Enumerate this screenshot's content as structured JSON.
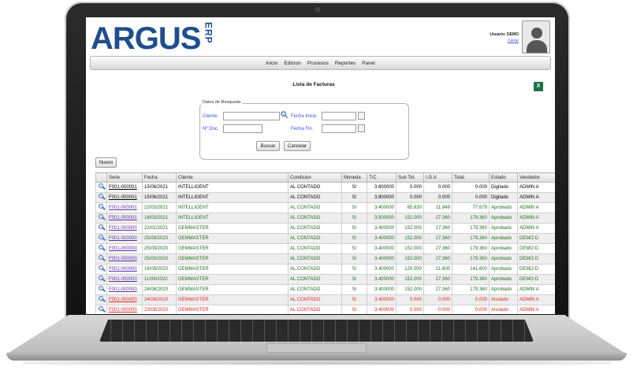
{
  "app": {
    "logo_text": "ARGUS",
    "logo_suffix": "ERP",
    "user_label": "Usuario: DEMO",
    "logout_label": "Cerrar"
  },
  "menu": [
    "Inicio",
    "Edicion",
    "Procesos",
    "Reportes",
    "Panel"
  ],
  "page_title": "Lista de Facturas",
  "search": {
    "legend": "Datos de Búsqueda",
    "cliente_label": "Cliente",
    "ndoc_label": "Nº Doc.",
    "fecha_inicio_label": "Fecha Inicio.",
    "fecha_fin_label": "Fecha Fin.",
    "buscar_label": "Buscar",
    "cancelar_label": "Cancelar"
  },
  "nuevo_label": "Nuevo",
  "table": {
    "headers": [
      "",
      "Serie",
      "Fecha",
      "Cliente",
      "Condicion",
      "Moneda",
      "T/C",
      "Sub Tot.",
      "I.G.V.",
      "Total",
      "Estado",
      "Vendedor"
    ],
    "rows": [
      {
        "status": "pending",
        "serie": "F001-000001",
        "fecha": "15/06/2021",
        "cliente": "INTELLIGENT",
        "condicion": "AL CONTADO",
        "moneda": "S/",
        "tc": "3.800000",
        "subtot": "0.000",
        "igv": "0.000",
        "total": "0.000",
        "estado": "Digitado",
        "vendedor": "ADMIN A"
      },
      {
        "status": "pending",
        "serie": "F001-000001",
        "fecha": "15/06/2021",
        "cliente": "INTELLIGENT",
        "condicion": "AL CONTADO",
        "moneda": "S/",
        "tc": "3.800000",
        "subtot": "0.000",
        "igv": "0.000",
        "total": "0.000",
        "estado": "Digitado",
        "vendedor": "ADMIN A"
      },
      {
        "status": "ok",
        "serie": "F001-000001",
        "fecha": "22/03/2021",
        "cliente": "INTELLIGENT",
        "condicion": "AL CONTADO",
        "moneda": "S/",
        "tc": "3.400000",
        "subtot": "65.830",
        "igv": "11.849",
        "total": "77.679",
        "estado": "Aprobado",
        "vendedor": "ADMIN A"
      },
      {
        "status": "ok",
        "serie": "F001-000001",
        "fecha": "16/03/2021",
        "cliente": "INTELLIGENT",
        "condicion": "AL CONTADO",
        "moneda": "S/",
        "tc": "3.500000",
        "subtot": "152.000",
        "igv": "27.360",
        "total": "179.360",
        "estado": "Aprobado",
        "vendedor": "ADMIN A"
      },
      {
        "status": "ok",
        "serie": "F001-000000",
        "fecha": "22/01/2021",
        "cliente": "GEMMASTER",
        "condicion": "AL CONTADO",
        "moneda": "S/",
        "tc": "3.400000",
        "subtot": "152.000",
        "igv": "27.360",
        "total": "179.360",
        "estado": "Aprobado",
        "vendedor": "ADMIN A"
      },
      {
        "status": "ok",
        "serie": "F001-000000",
        "fecha": "25/09/2020",
        "cliente": "GEMMASTER",
        "condicion": "AL CONTADO",
        "moneda": "S/",
        "tc": "3.400000",
        "subtot": "152.000",
        "igv": "27.360",
        "total": "179.360",
        "estado": "Aprobado",
        "vendedor": "DEMO D"
      },
      {
        "status": "ok",
        "serie": "F001-000000",
        "fecha": "25/09/2020",
        "cliente": "GEMMASTER",
        "condicion": "AL CONTADO",
        "moneda": "S/",
        "tc": "3.400000",
        "subtot": "152.000",
        "igv": "27.360",
        "total": "179.360",
        "estado": "Aprobado",
        "vendedor": "DEMO D"
      },
      {
        "status": "ok",
        "serie": "F001-000000",
        "fecha": "25/09/2020",
        "cliente": "GEMMASTER",
        "condicion": "AL CONTADO",
        "moneda": "S/",
        "tc": "3.400000",
        "subtot": "152.000",
        "igv": "27.360",
        "total": "179.360",
        "estado": "Aprobado",
        "vendedor": "DEMO D"
      },
      {
        "status": "ok",
        "serie": "F001-000000",
        "fecha": "16/09/2020",
        "cliente": "GEMMASTER",
        "condicion": "AL CONTADO",
        "moneda": "S/",
        "tc": "3.400000",
        "subtot": "120.000",
        "igv": "21.600",
        "total": "141.600",
        "estado": "Aprobado",
        "vendedor": "DEMO D"
      },
      {
        "status": "ok",
        "serie": "F001-000000",
        "fecha": "11/09/2020",
        "cliente": "GEMMASTER",
        "condicion": "AL CONTADO",
        "moneda": "S/",
        "tc": "3.400000",
        "subtot": "152.000",
        "igv": "27.360",
        "total": "179.360",
        "estado": "Aprobado",
        "vendedor": "DEMO D"
      },
      {
        "status": "ok",
        "serie": "F001-000000",
        "fecha": "24/08/2020",
        "cliente": "GEMMASTER",
        "condicion": "AL CONTADO",
        "moneda": "S/",
        "tc": "3.400000",
        "subtot": "152.000",
        "igv": "27.360",
        "total": "179.360",
        "estado": "Aprobado",
        "vendedor": "ADMIN A"
      },
      {
        "status": "void",
        "serie": "F001-000000",
        "fecha": "24/08/2020",
        "cliente": "GEMMASTER",
        "condicion": "AL CONTADO",
        "moneda": "S/",
        "tc": "3.400000",
        "subtot": "0.000",
        "igv": "0.000",
        "total": "0.000",
        "estado": "Anulado",
        "vendedor": "ADMIN A"
      },
      {
        "status": "void",
        "serie": "F001-000000",
        "fecha": "23/08/2020",
        "cliente": "GEMMASTER",
        "condicion": "AL CONTADO",
        "moneda": "S/",
        "tc": "3.400000",
        "subtot": "0.000",
        "igv": "0.000",
        "total": "0.000",
        "estado": "Anulado",
        "vendedor": "ADMIN A"
      }
    ]
  },
  "colors": {
    "brand": "#1f4e8c",
    "link": "#3b4fd6",
    "approved": "#1f6d1f",
    "voided": "#e02424"
  }
}
